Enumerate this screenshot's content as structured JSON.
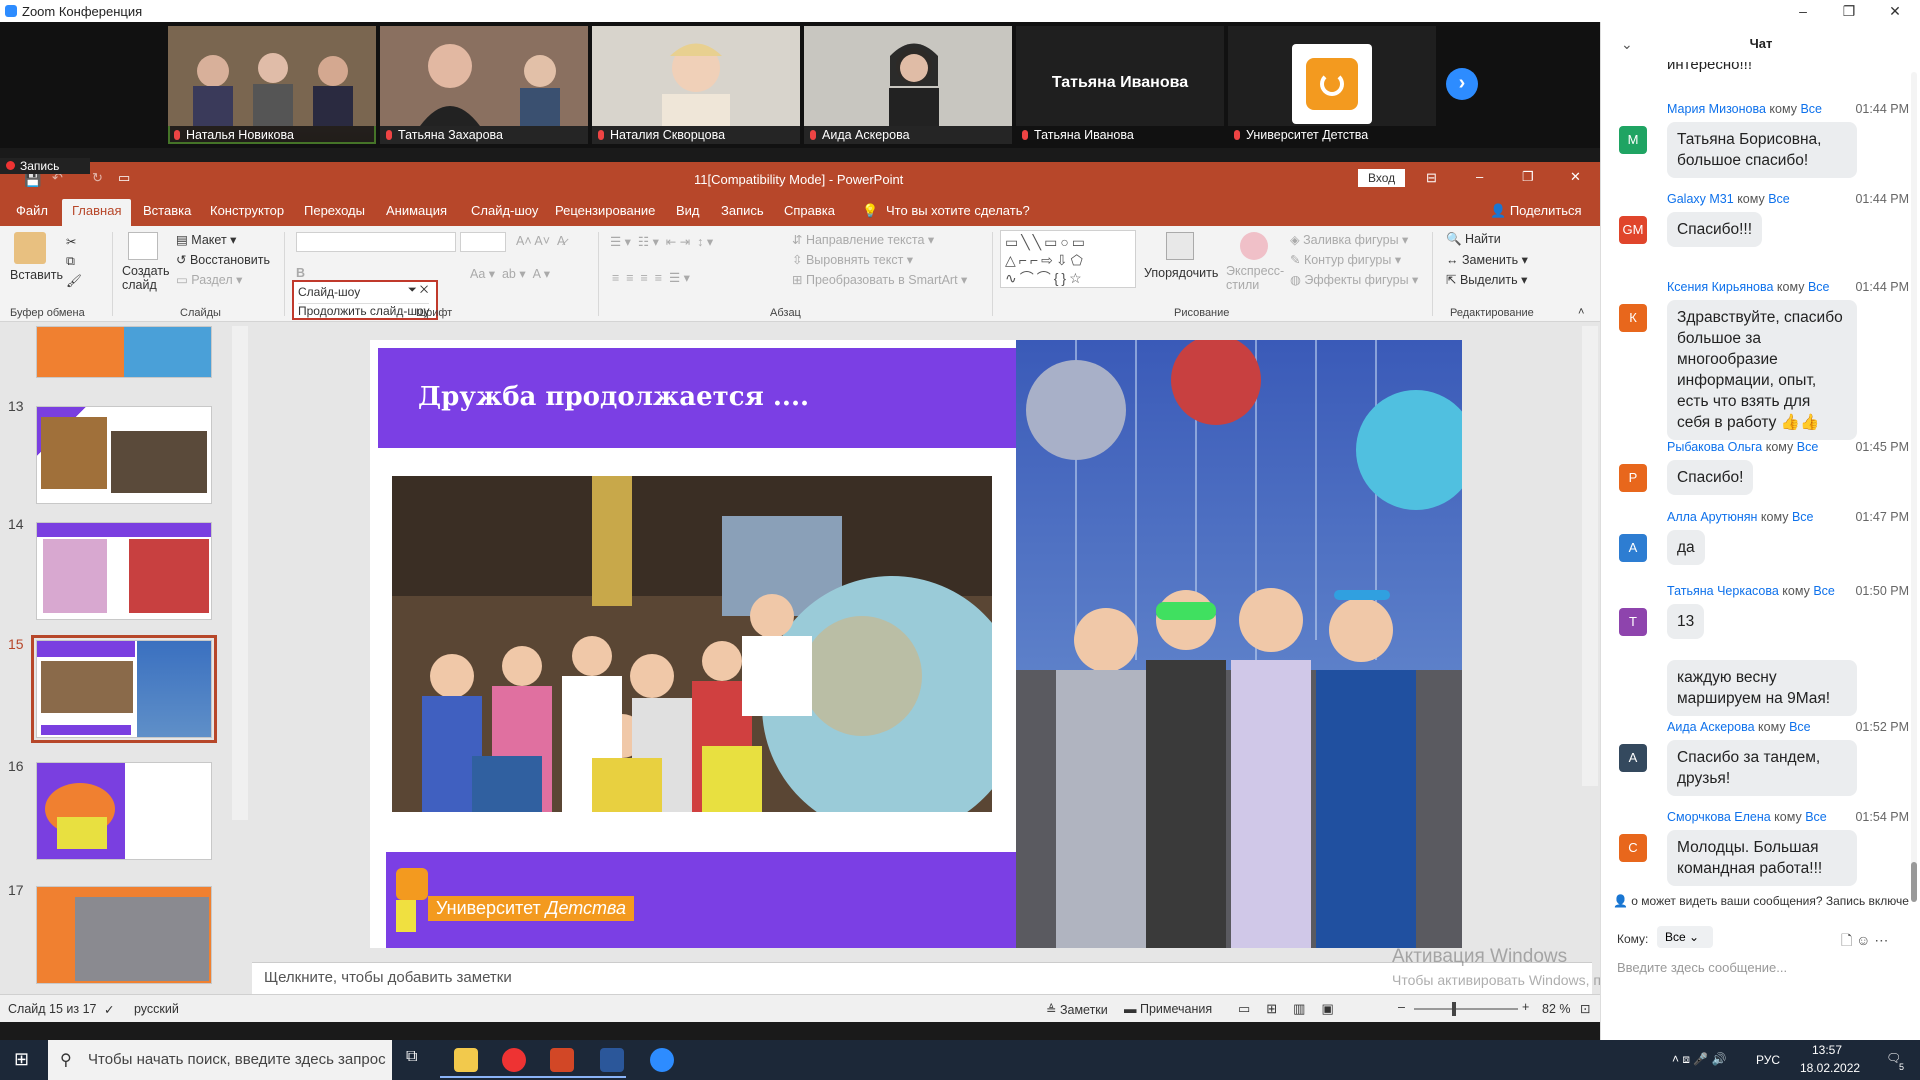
{
  "zoom": {
    "title": "Zoom Конференция",
    "participants": [
      "Наталья Новикова",
      "Татьяна Захарова",
      "Наталия Скворцова",
      "Аида Аскерова",
      "Татьяна Иванова",
      "Университет Детства"
    ],
    "recording": "Запись"
  },
  "ppt": {
    "file_title": "11[Compatibility Mode]  -  PowerPoint",
    "signin": "Вход",
    "tabs": [
      "Файл",
      "Главная",
      "Вставка",
      "Конструктор",
      "Переходы",
      "Анимация",
      "Слайд-шоу",
      "Рецензирование",
      "Вид",
      "Запись",
      "Справка",
      "Что вы хотите сделать?"
    ],
    "share": "Поделиться",
    "ribbon": {
      "paste": "Вставить",
      "clipboard": "Буфер обмена",
      "create_slide": "Создать слайд",
      "layout": "Макет",
      "reset": "Восстановить",
      "section": "Раздел",
      "slides": "Слайды",
      "font": "Шрифт",
      "paragraph": "Абзац",
      "drawing": "Рисование",
      "editing": "Редактирование",
      "find": "Найти",
      "replace": "Заменить",
      "select": "Выделить",
      "arrange": "Упорядочить",
      "quick_styles": "Экспресс-стили",
      "shape_fill": "Заливка фигуры",
      "shape_outline": "Контур фигуры",
      "shape_effects": "Эффекты фигуры",
      "text_direction": "Направление текста",
      "align_text": "Выровнять текст",
      "smartart": "Преобразовать в SmartArt",
      "slideshow_dropdown": "Слайд-шоу",
      "continue_show": "Продолжить слайд-шоу"
    },
    "slide_numbers": [
      "13",
      "14",
      "15",
      "16",
      "17"
    ],
    "slide": {
      "title": "Дружба продолжается ....",
      "logo_text_1": "Университет",
      "logo_text_2": "Детства"
    },
    "notes_placeholder": "Щелкните, чтобы добавить заметки",
    "status": {
      "slide": "Слайд 15 из 17",
      "lang": "русский",
      "notes": "Заметки",
      "comments": "Примечания",
      "zoom": "82 %"
    }
  },
  "watermark": {
    "line1": "Активация Windows",
    "line2": "Чтобы активировать Windows, перейдите в раздел \"Параметры\"."
  },
  "chat": {
    "title": "Чат",
    "cut_text": "интересно!!!",
    "messages": [
      {
        "name": "Мария Мизонова",
        "to": "кому",
        "all": "Все",
        "time": "01:44 PM",
        "initial": "М",
        "color": "#1fa463",
        "text": "Татьяна Борисовна, большое спасибо!"
      },
      {
        "name": "Galaxy M31",
        "to": "кому",
        "all": "Все",
        "time": "01:44 PM",
        "initial": "GM",
        "color": "#e0452b",
        "text": "Спасибо!!!"
      },
      {
        "name": "Ксения Кирьянова",
        "to": "кому",
        "all": "Все",
        "time": "01:44 PM",
        "initial": "К",
        "color": "#e8671c",
        "text": "Здравствуйте, спасибо большое за многообразие информации, опыт, есть что взять для себя в работу 👍👍"
      },
      {
        "name": "Рыбакова Ольга",
        "to": "кому",
        "all": "Все",
        "time": "01:45 PM",
        "initial": "Р",
        "color": "#e8671c",
        "text": "Спасибо!"
      },
      {
        "name": "Алла Арутюнян",
        "to": "кому",
        "all": "Все",
        "time": "01:47 PM",
        "initial": "А",
        "color": "#2d7dd2",
        "text": "да"
      },
      {
        "name": "Татьяна Черкасова",
        "to": "кому",
        "all": "Все",
        "time": "01:50 PM",
        "initial": "Т",
        "color": "#8e44ad",
        "text": "13",
        "text2": "каждую весну маршируем на 9Мая!"
      },
      {
        "name": "Аида Аскерова",
        "to": "кому",
        "all": "Все",
        "time": "01:52 PM",
        "initial": "А",
        "color": "#34495e",
        "text": "Спасибо за тандем, друзья!"
      },
      {
        "name": "Сморчкова Елена",
        "to": "кому",
        "all": "Все",
        "time": "01:54 PM",
        "initial": "С",
        "color": "#e8671c",
        "text": "Молодцы. Большая командная работа!!!"
      }
    ],
    "notice": "о может видеть ваши сообщения? Запись включе",
    "to_label": "Кому:",
    "to_value": "Все",
    "placeholder": "Введите здесь сообщение..."
  },
  "taskbar": {
    "search": "Чтобы начать поиск, введите здесь запрос",
    "lang": "РУС",
    "time": "13:57",
    "date": "18.02.2022",
    "notif": "5"
  }
}
